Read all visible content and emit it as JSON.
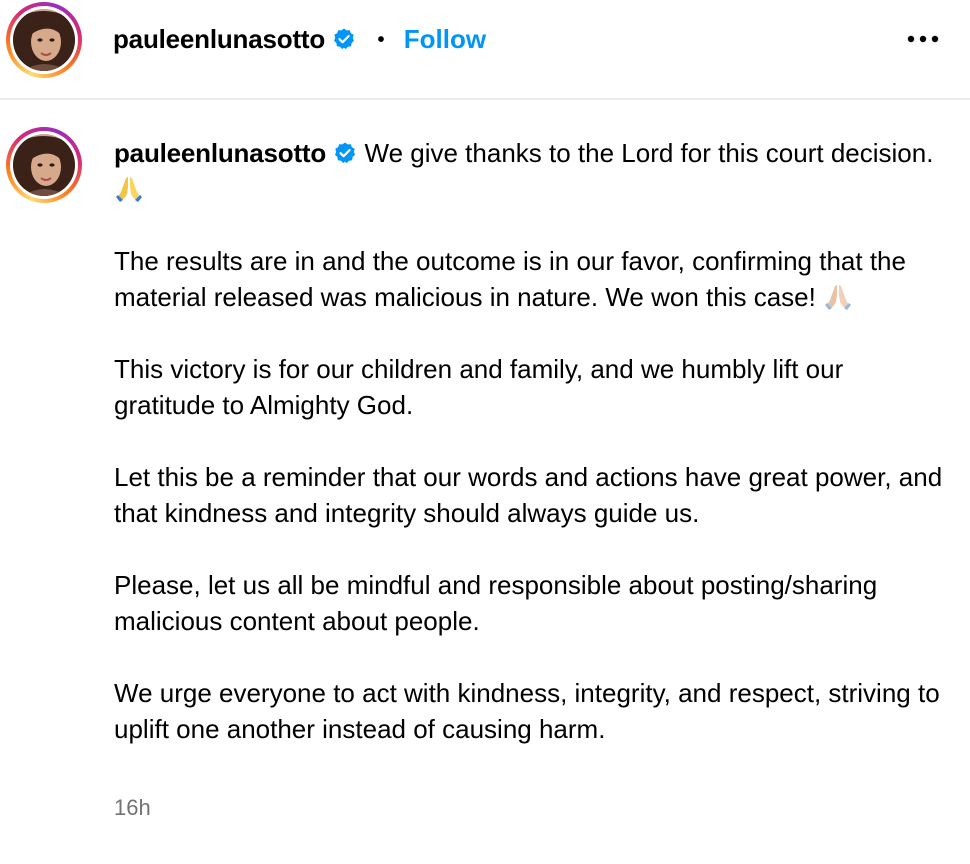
{
  "header": {
    "username": "pauleenlunasotto",
    "separator": "•",
    "follow_label": "Follow",
    "more_icon": "more-horizontal-icon",
    "verified_icon": "verified-badge-icon",
    "avatar_icon": "profile-avatar"
  },
  "caption": {
    "username": "pauleenlunasotto",
    "first_line": " We give thanks to the Lord for this court decision. ",
    "paragraphs": [
      "The results are in and the outcome is in our favor, confirming that the material released was malicious in nature. We won this case! ",
      "This victory is for our children and family, and we humbly lift our gratitude to Almighty God.",
      "Let this be a reminder that our words and actions have great power, and that kindness and integrity should always guide us.",
      "Please, let us all be mindful and responsible about posting/sharing malicious content about people.",
      "We urge everyone to act with kindness, integrity, and respect, striving to uplift one another instead of causing harm."
    ],
    "timestamp": "16h"
  },
  "colors": {
    "accent": "#0095f6",
    "verified": "#0095f6",
    "muted": "#737373",
    "divider": "#ececec"
  }
}
